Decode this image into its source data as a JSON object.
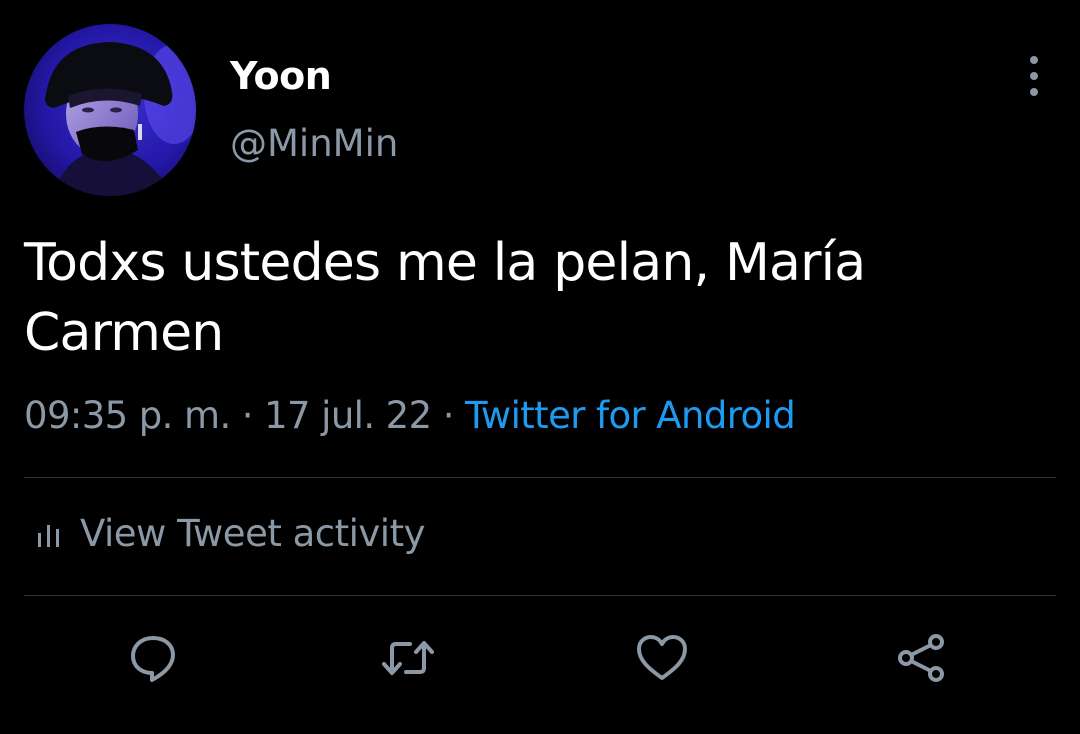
{
  "user": {
    "display_name": "Yoon",
    "handle": "@MinMin",
    "avatar": "profile-photo"
  },
  "tweet": {
    "text": "Todxs ustedes me la pelan, María Carmen",
    "time": "09:35 p. m.",
    "separator_1": " · ",
    "date": "17 jul. 22",
    "separator_2": " · ",
    "source": "Twitter for Android"
  },
  "activity": {
    "label": "View Tweet activity",
    "icon": "bar-chart-icon"
  },
  "actions": {
    "icons": [
      "reply-icon",
      "retweet-icon",
      "like-icon",
      "share-icon"
    ]
  },
  "menu": {
    "icon": "more-vertical-icon"
  },
  "colors": {
    "background": "#000000",
    "text": "#ffffff",
    "muted": "#8b98a5",
    "link": "#1d9bf0",
    "divider": "#2f3336"
  }
}
